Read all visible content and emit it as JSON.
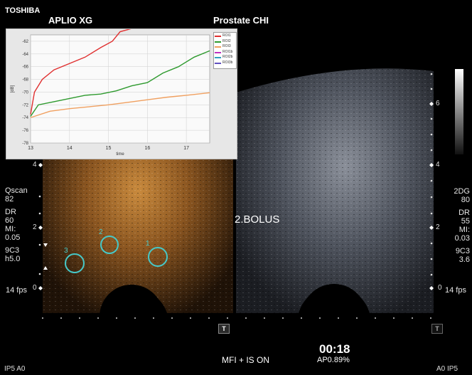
{
  "header": {
    "brand": "TOSHIBA",
    "system": "APLIO XG",
    "preset": "Prostate CHI"
  },
  "image": {
    "bolus_label": "2.BOLUS"
  },
  "rois": [
    "1",
    "2",
    "3"
  ],
  "depth": {
    "left": [
      "4",
      "2",
      "0"
    ],
    "right": [
      "6",
      "4",
      "2",
      "0"
    ]
  },
  "left_params": [
    "Qscan",
    "82",
    "DR",
    "60",
    "MI:",
    "0.05",
    "9C3",
    "h5.0",
    "14 fps"
  ],
  "right_params": [
    "2DG",
    "80",
    "DR",
    "55",
    "MI:",
    "0.03",
    "9C3",
    "3.6",
    "14 fps"
  ],
  "buttons": {
    "t_left": "T",
    "t_right": "T"
  },
  "footer": {
    "mode_status": "MFI + IS ON",
    "timer": "00:18",
    "acoustic_power": "AP0.89%",
    "left": "IP5  A0",
    "right": "A0  IP5"
  },
  "chart_data": {
    "type": "line",
    "title": "",
    "xlabel": "time",
    "ylabel": "[dB]",
    "xlim": [
      13,
      17.6
    ],
    "ylim": [
      -78,
      -61
    ],
    "x_ticks": [
      13,
      14,
      15,
      16,
      17
    ],
    "y_ticks": [
      -62,
      -64,
      -66,
      -68,
      -70,
      -72,
      -74,
      -76,
      -78
    ],
    "grid": true,
    "legend_position": "top-right",
    "series": [
      {
        "name": "ROI1",
        "color": "#e03030",
        "x": [
          13.0,
          13.1,
          13.3,
          13.6,
          14.0,
          14.4,
          14.8,
          15.1,
          15.3,
          15.6,
          16.0,
          16.4,
          16.8,
          17.1,
          17.4,
          17.6
        ],
        "values": [
          -73.5,
          -70,
          -68,
          -66.5,
          -65.5,
          -64.5,
          -63,
          -62,
          -60.5,
          -60,
          -59,
          -57.5,
          -56.5,
          -55.5,
          -55,
          -54.6
        ]
      },
      {
        "name": "ROI2",
        "color": "#2e9a2e",
        "x": [
          13.0,
          13.2,
          13.6,
          14.0,
          14.4,
          14.8,
          15.2,
          15.6,
          16.0,
          16.4,
          16.8,
          17.2,
          17.6
        ],
        "values": [
          -73.8,
          -72,
          -71.5,
          -71,
          -70.5,
          -70.3,
          -69.8,
          -69,
          -68.5,
          -67,
          -66,
          -64.5,
          -63.5
        ]
      },
      {
        "name": "ROI3",
        "color": "#f0a060",
        "x": [
          13.0,
          13.5,
          14.0,
          14.5,
          15.0,
          15.5,
          16.0,
          16.5,
          17.0,
          17.6
        ],
        "values": [
          -74,
          -73,
          -72.6,
          -72.3,
          -72,
          -71.6,
          -71.2,
          -70.8,
          -70.5,
          -70.1
        ]
      },
      {
        "name": "ROI1b",
        "color": "#c030c0",
        "x": [],
        "values": []
      },
      {
        "name": "ROI2b",
        "color": "#30a0c0",
        "x": [],
        "values": []
      },
      {
        "name": "ROI3b",
        "color": "#6050c0",
        "x": [],
        "values": []
      }
    ]
  }
}
